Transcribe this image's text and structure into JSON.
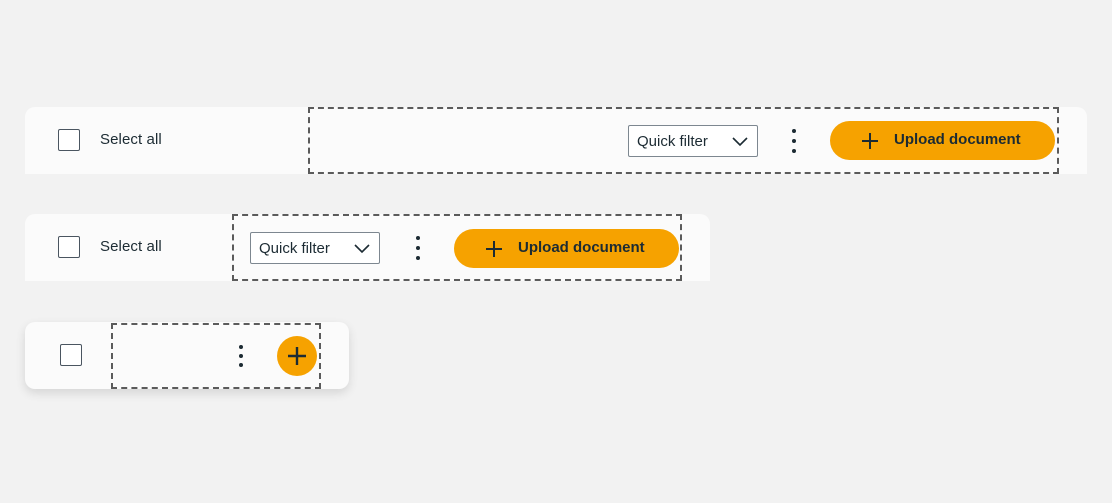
{
  "colors": {
    "background": "#f2f2f2",
    "toolbar": "#fbfbfb",
    "accent": "#f6a200",
    "text": "#1c2b33"
  },
  "toolbar_wide": {
    "select_all_label": "Select all",
    "quick_filter_label": "Quick filter",
    "upload_label": "Upload document",
    "icons": [
      "chevron-down-icon",
      "kebab-menu-icon",
      "plus-icon"
    ]
  },
  "toolbar_medium": {
    "select_all_label": "Select all",
    "quick_filter_label": "Quick filter",
    "upload_label": "Upload document",
    "icons": [
      "chevron-down-icon",
      "kebab-menu-icon",
      "plus-icon"
    ]
  },
  "toolbar_compact": {
    "icons": [
      "kebab-menu-icon",
      "plus-icon"
    ]
  }
}
